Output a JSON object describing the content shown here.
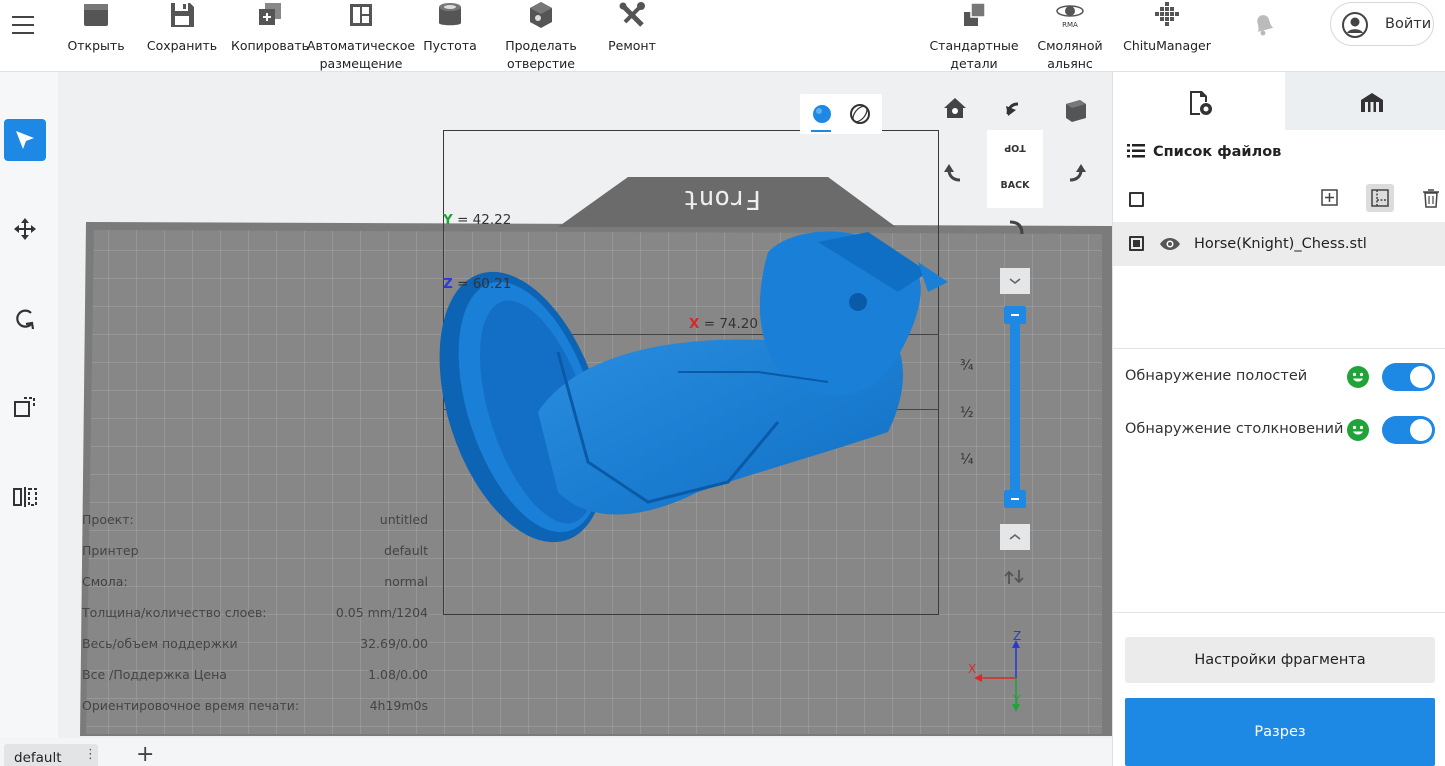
{
  "toolbar": {
    "open": "Открыть",
    "save": "Сохранить",
    "copy": "Копировать",
    "auto_arrange": "Автоматическое\nразмещение",
    "hollow": "Пустота",
    "drill_hole": "Проделать\nотверстие",
    "repair": "Ремонт",
    "standard_parts": "Стандартные\nдетали",
    "resin_alliance": "Смоляной\nальянс",
    "chitu_manager": "ChituManager",
    "login": "Войти"
  },
  "viewport": {
    "plate_label": "Front",
    "dimensions": {
      "y_axis": "Y",
      "y_value": "= 42.22",
      "z_axis": "Z",
      "z_value": "= 60.21",
      "x_axis": "X",
      "x_value": "= 74.20"
    },
    "view_cube": {
      "top": "TOP",
      "back": "BACK"
    },
    "fractions": [
      "¾",
      "½",
      "¼"
    ],
    "axis_labels": {
      "x": "X",
      "y": "Y",
      "z": "Z"
    }
  },
  "info": [
    {
      "key": "Проект:",
      "value": "untitled"
    },
    {
      "key": "Принтер",
      "value": "default"
    },
    {
      "key": "Смола:",
      "value": "normal"
    },
    {
      "key": "Толщина/количество слоев:",
      "value": "0.05 mm/1204"
    },
    {
      "key": "Весь/объем поддержки",
      "value": "32.69/0.00"
    },
    {
      "key": "Все /Поддержка Цена",
      "value": "1.08/0.00"
    },
    {
      "key": "Ориентировочное время печати:",
      "value": "4h19m0s"
    }
  ],
  "bottom_tabs": {
    "default_tab": "default",
    "more": "⋮",
    "add": "+"
  },
  "right_panel": {
    "file_list_title": "Список файлов",
    "file_name": "Horse(Knight)_Chess.stl",
    "cavity_detection": "Обнаружение полостей",
    "collision_detection": "Обнаружение столкновений",
    "slice_settings_button": "Настройки фрагмента",
    "slice_button": "Разрез"
  },
  "colors": {
    "accent": "#1e88e5",
    "model": "#1a7fd6",
    "status_ok": "#21a33a"
  }
}
